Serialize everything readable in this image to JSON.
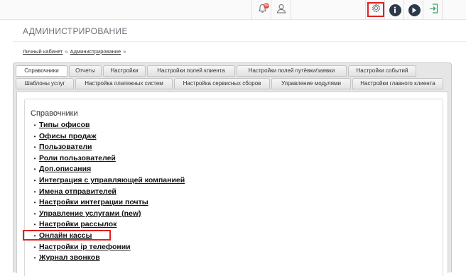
{
  "topbar": {
    "notification_count": "59",
    "icons": [
      "bell-icon",
      "user-icon",
      "gear-icon",
      "info-icon",
      "play-icon",
      "login-icon"
    ],
    "accent_highlight": "#e02020",
    "dark_icon_color": "#2b3a48",
    "green_icon_color": "#27a35c"
  },
  "header": {
    "title": "АДМИНИСТРИРОВАНИЕ"
  },
  "breadcrumb": {
    "items": [
      "Личный кабинет",
      "Администрирование"
    ],
    "separator": "»"
  },
  "tabs": {
    "row1": [
      "Справочники",
      "Отчеты",
      "Настройки",
      "Настройки полей клиента",
      "Настройки полей путёвки/заявки",
      "Настройки событий"
    ],
    "row2": [
      "Шаблоны услуг",
      "Настройка платежных систем",
      "Настройка сервисных сборов",
      "Управление модулями",
      "Настройки главного клиента"
    ],
    "active": "Справочники"
  },
  "main": {
    "section_title": "Справочники",
    "links": [
      "Типы офисов",
      "Офисы продаж",
      "Пользователи",
      "Роли пользователей",
      "Доп.описания",
      "Интеграция с управляющей компанией",
      "Имена отправителей",
      "Настройки интеграции почты",
      "Управление услугами (new)",
      "Настройки рассылок",
      "Онлайн кассы",
      "Настройки ip телефонии",
      "Журнал звонков"
    ],
    "bullet": "•"
  }
}
